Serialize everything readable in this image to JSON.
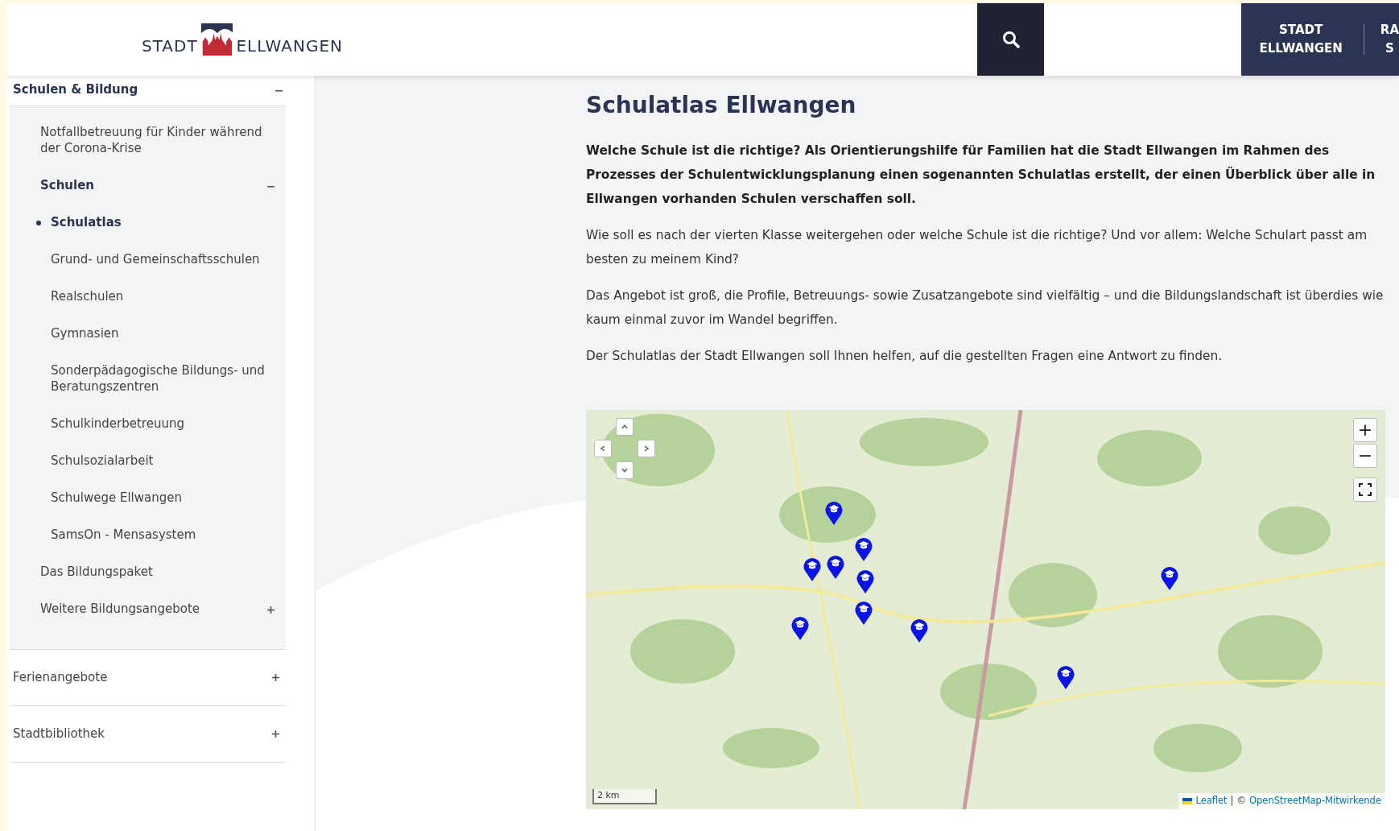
{
  "header": {
    "logo": {
      "left": "STADT",
      "right": "ELLWANGEN"
    },
    "nav": [
      {
        "lines": [
          "STADT",
          "ELLWANGEN"
        ]
      },
      {
        "lines": [
          "RA",
          "S"
        ]
      }
    ]
  },
  "sidebar": {
    "section": {
      "label": "Schulen & Bildung",
      "expanded": true,
      "children": [
        {
          "label": "Notfallbetreuung für Kinder während der Corona-Krise",
          "selected": false
        },
        {
          "label": "Schulen",
          "selected": false,
          "expanded": true,
          "children": [
            {
              "label": "Schulatlas",
              "selected": true
            },
            {
              "label": "Grund- und Gemeinschaftsschulen",
              "selected": false
            },
            {
              "label": "Realschulen",
              "selected": false
            },
            {
              "label": "Gymnasien",
              "selected": false
            },
            {
              "label": "Sonderpädagogische Bildungs- und Beratungszentren",
              "selected": false
            },
            {
              "label": "Schulkinderbetreuung",
              "selected": false
            },
            {
              "label": "Schulsozialarbeit",
              "selected": false
            },
            {
              "label": "Schulwege Ellwangen",
              "selected": false
            },
            {
              "label": "SamsOn - Mensasystem",
              "selected": false
            }
          ]
        },
        {
          "label": "Das Bildungspaket",
          "selected": false
        },
        {
          "label": "Weitere Bildungsangebote",
          "selected": false,
          "expanded": false
        }
      ]
    },
    "others": [
      {
        "label": "Ferienangebote",
        "expanded": false
      },
      {
        "label": "Stadtbibliothek",
        "expanded": false
      }
    ]
  },
  "main": {
    "title": "Schulatlas Ellwangen",
    "paragraphs": [
      {
        "kind": "intro",
        "text": "Welche Schule ist die richtige? Als Orientierungshilfe für Familien hat die Stadt Ellwangen im Rahmen des Prozesses der Schulentwicklungsplanung einen sogenannten Schulatlas erstellt, der einen Überblick über alle in Ellwangen vorhanden Schulen verschaffen soll."
      },
      {
        "kind": "text",
        "text": "Wie soll es nach der vierten Klasse weitergehen oder welche Schule ist die richtige? Und vor allem: Welche Schulart passt am besten zu meinem Kind?"
      },
      {
        "kind": "text",
        "text": "Das Angebot ist groß, die Profile, Betreuungs- sowie Zusatzangebote sind vielfältig – und die Bildungslandschaft ist überdies wie kaum einmal zuvor im Wandel begriffen."
      },
      {
        "kind": "text",
        "text": "Der Schulatlas der Stadt Ellwangen soll Ihnen helfen, auf die gestellten Fragen eine Antwort zu finden."
      }
    ],
    "map": {
      "zoom_in": "+",
      "zoom_out": "−",
      "scale": "2 km",
      "attribution": {
        "leaflet": "Leaflet",
        "separator": "|",
        "copyright": "©",
        "osm": "OpenStreetMap-Mitwirkende"
      }
    }
  }
}
